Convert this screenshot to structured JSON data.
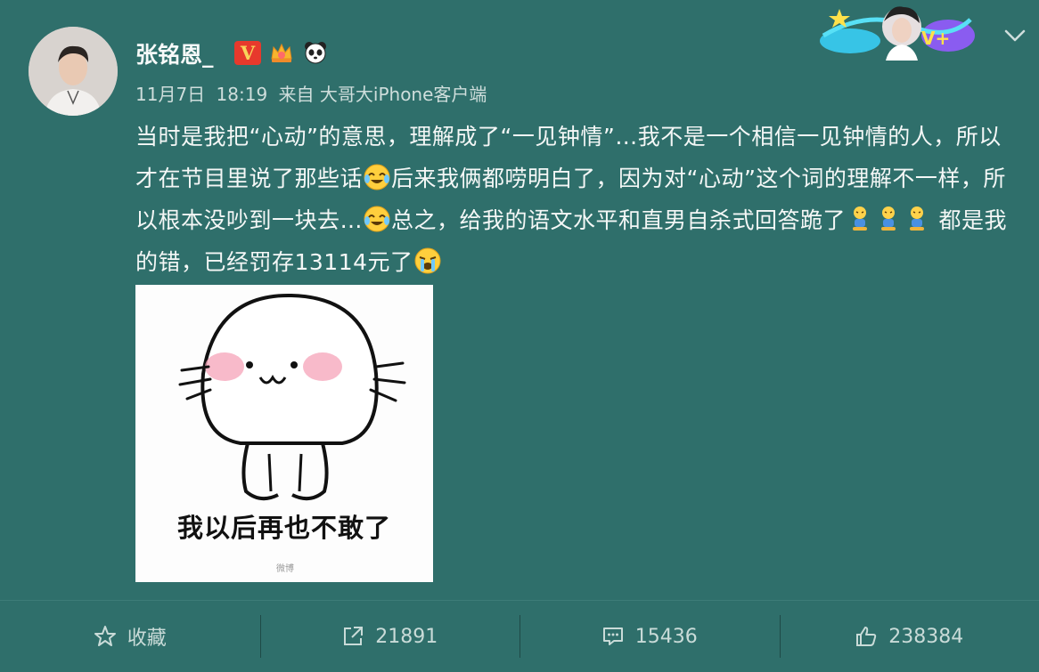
{
  "user": {
    "name": "张铭恩_",
    "verified_badge": "V",
    "icons": [
      "verified-v-icon",
      "crown-badge-icon",
      "panda-icon"
    ]
  },
  "post": {
    "date": "11月7日",
    "time": "18:19",
    "source": "来自 大哥大iPhone客户端",
    "text_parts": {
      "p1": "当时是我把“心动”的意思，理解成了“一见钟情”…我不是一个相信一见钟情的人，所以才在节目里说了那些话",
      "p2": "后来我俩都唠明白了，因为对“心动”这个词的理解不一样，所以根本没吵到一块去…",
      "p3": "总之，给我的语文水平和直男自杀式回答跪了",
      "p4": " 都是我的错，已经罚存13114元了"
    },
    "emoji_names": [
      "laugh-cry-emoji",
      "laugh-cry-emoji",
      "kneeling-emoji",
      "crying-emoji"
    ],
    "sticker": {
      "caption": "我以后再也不敢了"
    }
  },
  "actions": {
    "favorite": "收藏",
    "repost_count": "21891",
    "comment_count": "15436",
    "like_count": "238384"
  },
  "colors": {
    "background": "#2f6f6b",
    "text": "#f4f7f6",
    "muted": "#cfdedc",
    "vip_red": "#e7392c"
  }
}
